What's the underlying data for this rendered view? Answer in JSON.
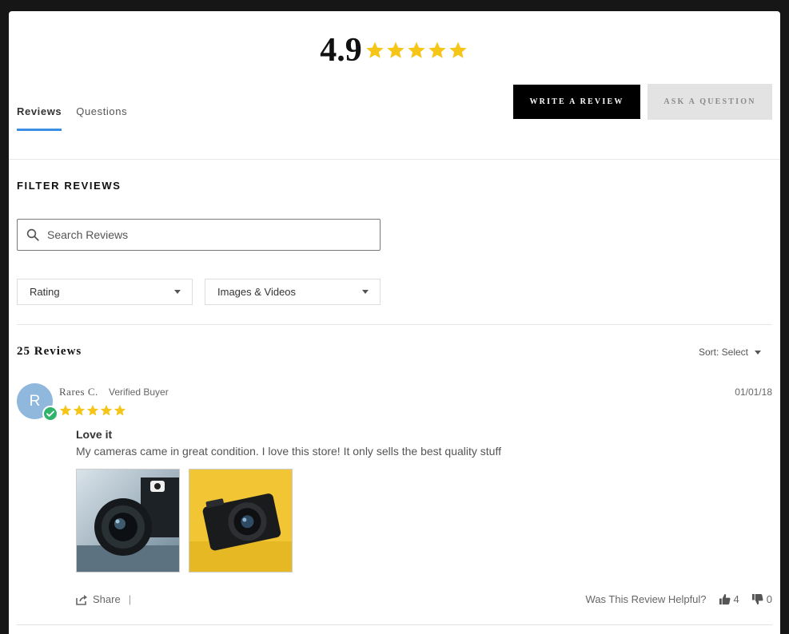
{
  "summary": {
    "average": "4.9",
    "star_count": 5,
    "star_color": "#f5c518"
  },
  "tabs": [
    {
      "label": "Reviews",
      "active": true
    },
    {
      "label": "Questions",
      "active": false
    }
  ],
  "buttons": {
    "write_review": "WRITE A REVIEW",
    "ask_question": "ASK A QUESTION"
  },
  "filters": {
    "title": "FILTER REVIEWS",
    "search_placeholder": "Search Reviews",
    "rating_label": "Rating",
    "media_label": "Images & Videos"
  },
  "reviews_header": {
    "count_label": "25 Reviews",
    "sort_label": "Sort: Select"
  },
  "review": {
    "avatar_initial": "R",
    "name": "Rares C.",
    "badge": "Verified Buyer",
    "date": "01/01/18",
    "stars": 5,
    "title": "Love it",
    "body": "My cameras came in great condition. I love this store! It only sells the best quality stuff",
    "share_label": "Share",
    "share_separator": "|",
    "helpful_question": "Was This Review Helpful?",
    "helpful_yes": "4",
    "helpful_no": "0"
  },
  "colors": {
    "accent": "#3a8ee6",
    "verified": "#2fb36b",
    "avatar": "#8fb8dc"
  }
}
